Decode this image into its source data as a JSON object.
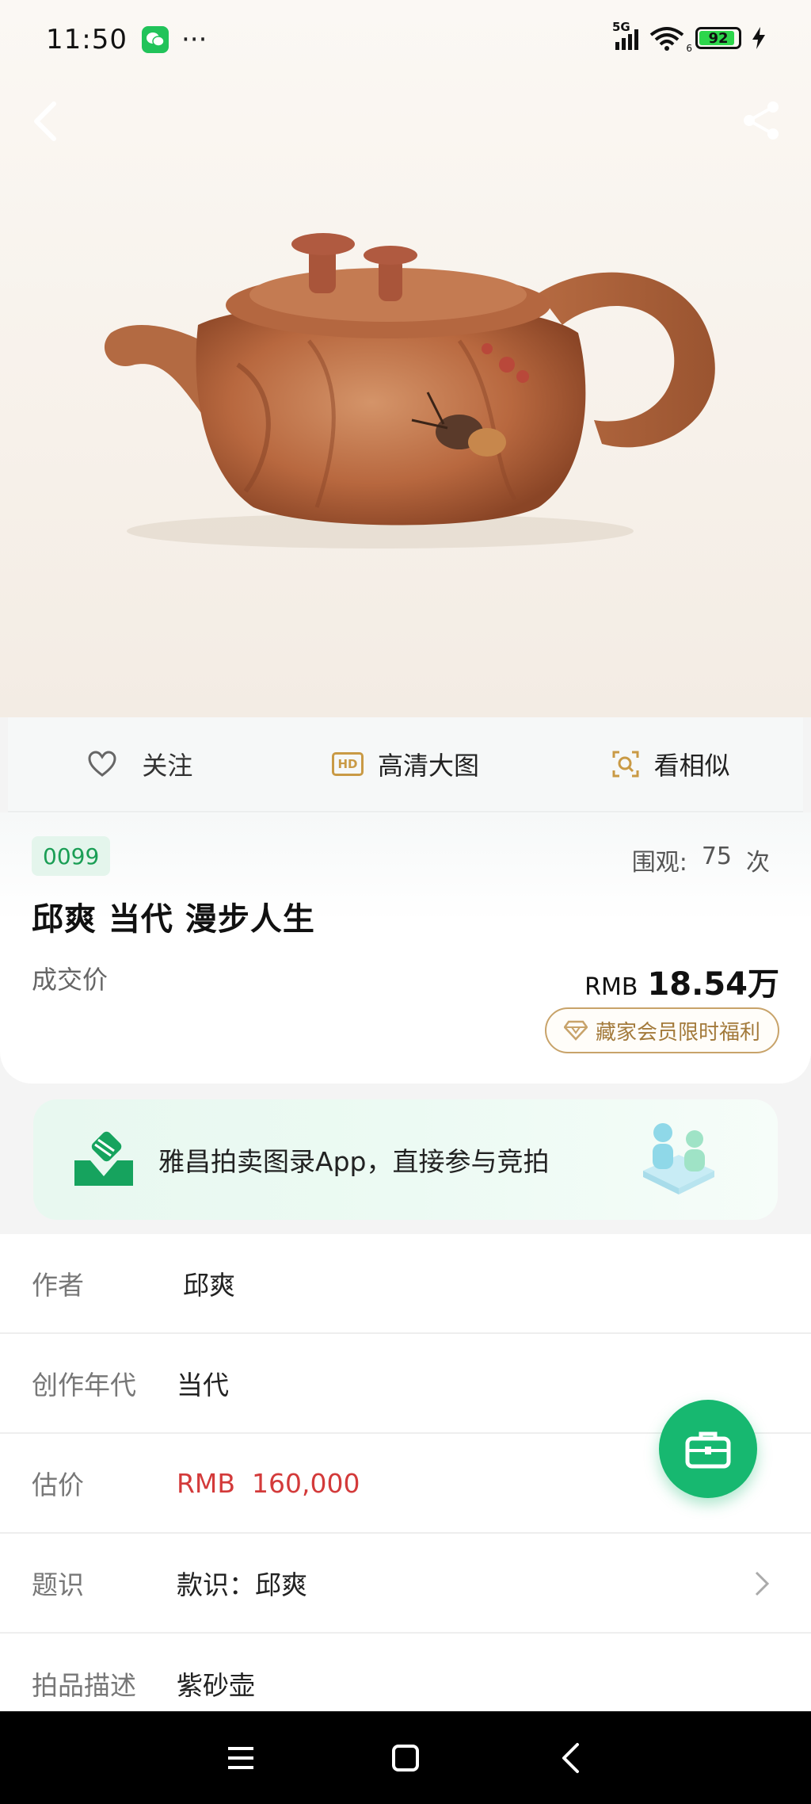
{
  "status_bar": {
    "time": "11:50",
    "dots": "···",
    "network": "5G",
    "wifi_sub": "6",
    "battery": "92",
    "battery_level": 0.92
  },
  "actions": {
    "follow": "关注",
    "hd_badge": "HD",
    "hd_view": "高清大图",
    "similar": "看相似"
  },
  "lot": {
    "number": "0099",
    "views_label": "围观:",
    "views_count": "75",
    "views_unit": "次",
    "title": "邱爽 当代 漫步人生",
    "deal_label": "成交价",
    "deal_currency": "RMB",
    "deal_value": "18.54万",
    "vip_label": "藏家会员限时福利"
  },
  "banner": {
    "text": "雅昌拍卖图录App，直接参与竞拍"
  },
  "details": {
    "author": {
      "key": "作者",
      "value": "邱爽"
    },
    "era": {
      "key": "创作年代",
      "value": "当代"
    },
    "estimate": {
      "key": "估价",
      "value": "RMB  160,000"
    },
    "inscription": {
      "key": "题识",
      "value": "款识：邱爽"
    },
    "description": {
      "key": "拍品描述",
      "value": "紫砂壶"
    }
  },
  "colors": {
    "accent_green": "#17b870",
    "price_red": "#d33a3a",
    "gold": "#c8a36a"
  },
  "icons": {
    "back": "chevron-left-icon",
    "share": "share-icon",
    "follow": "heart-icon",
    "hd": "hd-icon",
    "similar": "image-search-icon",
    "vip": "diamond-icon",
    "fab": "briefcase-icon",
    "row_more": "chevron-right-icon"
  }
}
